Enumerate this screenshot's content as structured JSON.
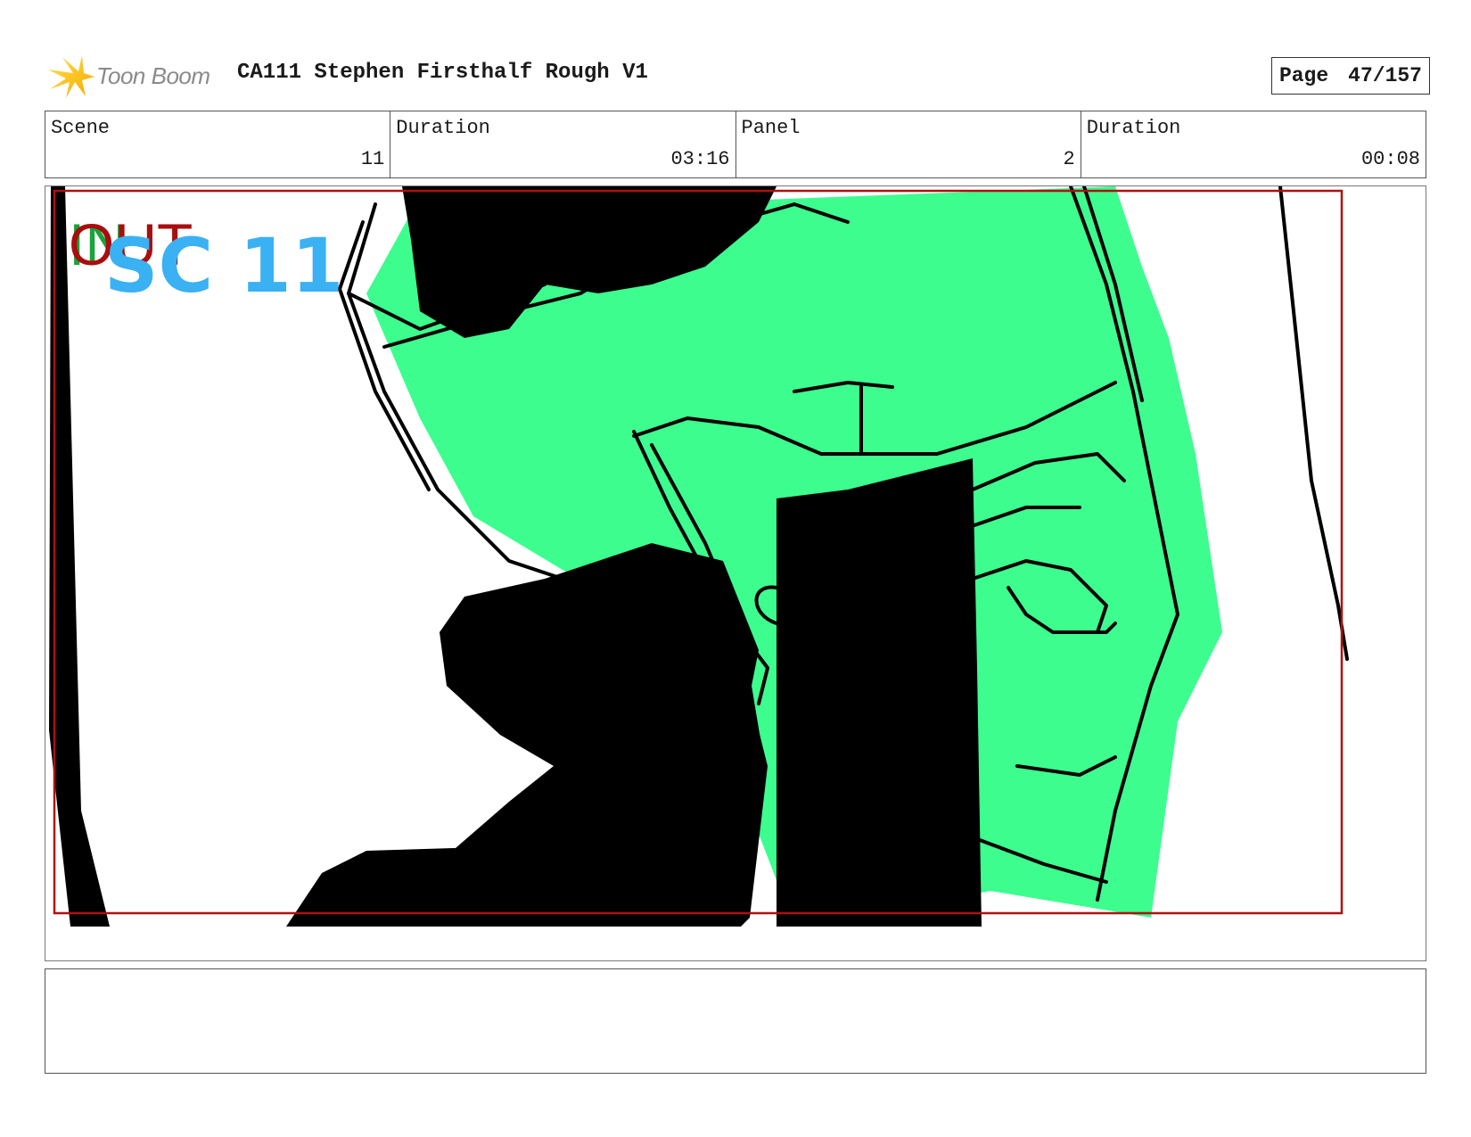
{
  "header": {
    "brand": "Toon Boom",
    "title": "CA111 Stephen Firsthalf Rough V1",
    "page_label": "Page",
    "page_number": "47/157"
  },
  "info": {
    "scene_label": "Scene",
    "scene_value": "11",
    "scene_duration_label": "Duration",
    "scene_duration_value": "03:16",
    "panel_label": "Panel",
    "panel_value": "2",
    "panel_duration_label": "Duration",
    "panel_duration_value": "00:08"
  },
  "panel_art": {
    "marker_in": "IN",
    "marker_out": "OUT",
    "scene_note": "SC 11"
  },
  "colors": {
    "fill_green": "#3dfd8f",
    "ink": "#000000",
    "frame_red": "#b01010",
    "marker_in": "#19a33c",
    "marker_out": "#a80e0e",
    "scene_note": "#3ab1f3"
  },
  "notes": {}
}
